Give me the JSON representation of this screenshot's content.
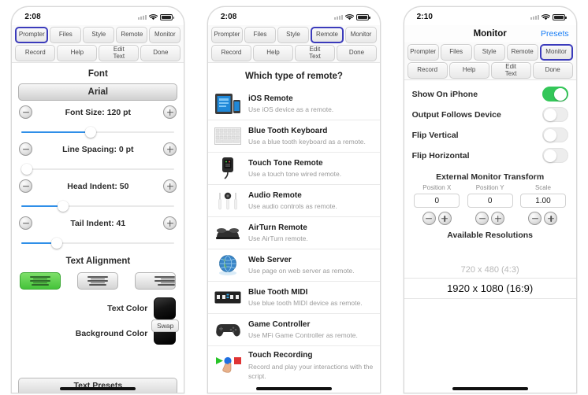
{
  "phones": [
    {
      "status": {
        "time": "2:08",
        "wifi": "wifi-icon",
        "battery": "battery-icon",
        "signal": "signal-icon"
      },
      "toolbar": {
        "row1": [
          "Prompter",
          "Files",
          "Style",
          "Remote",
          "Monitor"
        ],
        "row2": [
          "Record",
          "Help",
          "Edit Text",
          "Done"
        ],
        "selected": "Style"
      },
      "style": {
        "section_title": "Font",
        "font_name": "Arial",
        "controls": [
          {
            "label": "Font Size: 120 pt",
            "minus": "minus-button",
            "plus": "plus-button",
            "slider_pct": 45
          },
          {
            "label": "Line Spacing: 0 pt",
            "minus": "minus-button",
            "plus": "plus-button",
            "slider_pct": 0
          },
          {
            "label": "Head Indent: 50",
            "minus": "minus-button",
            "plus": "plus-button",
            "slider_pct": 27
          },
          {
            "label": "Tail Indent: 41",
            "minus": "minus-button",
            "plus": "plus-button",
            "slider_pct": 23
          }
        ],
        "alignment_title": "Text Alignment",
        "alignment_options": [
          "align-left",
          "align-center",
          "align-right"
        ],
        "alignment_selected": "align-left",
        "text_color_label": "Text Color",
        "background_color_label": "Background Color",
        "text_color": "#121212",
        "background_color": "#121212",
        "swap_label": "Swap",
        "presets_label": "Text Presets"
      }
    },
    {
      "status": {
        "time": "2:08",
        "wifi": "wifi-icon",
        "battery": "battery-icon",
        "signal": "signal-icon"
      },
      "toolbar": {
        "row1": [
          "Prompter",
          "Files",
          "Style",
          "Remote",
          "Monitor"
        ],
        "row2": [
          "Record",
          "Help",
          "Edit Text",
          "Done"
        ],
        "selected": "Remote"
      },
      "remote": {
        "heading": "Which type of remote?",
        "items": [
          {
            "icon": "ios-device-icon",
            "title": "iOS Remote",
            "subtitle": "Use iOS device as a remote."
          },
          {
            "icon": "keyboard-icon",
            "title": "Blue Tooth Keyboard",
            "subtitle": "Use a blue tooth keyboard as a remote."
          },
          {
            "icon": "touch-tone-remote-icon",
            "title": "Touch Tone Remote",
            "subtitle": "Use a touch tone wired remote."
          },
          {
            "icon": "earbuds-icon",
            "title": "Audio Remote",
            "subtitle": "Use audio controls as remote."
          },
          {
            "icon": "airturn-pedal-icon",
            "title": "AirTurn Remote",
            "subtitle": "Use AirTurn remote."
          },
          {
            "icon": "globe-icon",
            "title": "Web Server",
            "subtitle": "Use page on web server as remote."
          },
          {
            "icon": "midi-device-icon",
            "title": "Blue Tooth MIDI",
            "subtitle": "Use blue tooth MIDI device as remote."
          },
          {
            "icon": "gamepad-icon",
            "title": "Game Controller",
            "subtitle": "Use MFi Game Controller as remote."
          },
          {
            "icon": "touch-recording-icon",
            "title": "Touch Recording",
            "subtitle": "Record and play your interactions with the script."
          }
        ]
      }
    },
    {
      "status": {
        "time": "2:10",
        "wifi": "wifi-icon",
        "battery": "battery-icon",
        "signal": "signal-icon"
      },
      "navbar": {
        "title": "Monitor",
        "right_link": "Presets"
      },
      "toolbar": {
        "row1": [
          "Prompter",
          "Files",
          "Style",
          "Remote",
          "Monitor"
        ],
        "row2": [
          "Record",
          "Help",
          "Edit Text",
          "Done"
        ],
        "selected": "Monitor"
      },
      "monitor": {
        "switches": [
          {
            "label": "Show On iPhone",
            "on": true
          },
          {
            "label": "Output Follows Device",
            "on": false
          },
          {
            "label": "Flip Vertical",
            "on": false
          },
          {
            "label": "Flip Horizontal",
            "on": false
          }
        ],
        "transform_title": "External Monitor Transform",
        "fields": [
          {
            "caption": "Position X",
            "value": "0"
          },
          {
            "caption": "Position Y",
            "value": "0"
          },
          {
            "caption": "Scale",
            "value": "1.00"
          }
        ],
        "resolutions_title": "Available Resolutions",
        "resolutions": [
          {
            "label": "720 x 480 (4:3)",
            "current": false
          },
          {
            "label": "1920 x 1080 (16:9)",
            "current": true
          }
        ]
      }
    }
  ],
  "colors": {
    "accent_blue": "#2f8fe8",
    "green": "#34c759",
    "selected_border": "#3b3bbb",
    "link": "#1a7ef5"
  }
}
